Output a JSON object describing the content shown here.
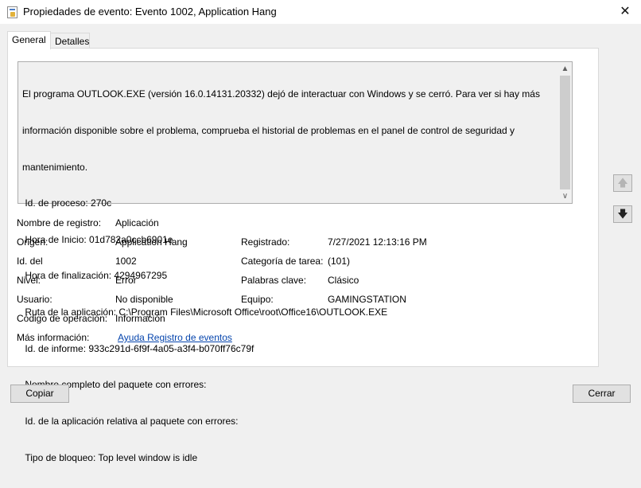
{
  "window": {
    "title": "Propiedades de evento: Evento 1002, Application Hang",
    "close_glyph": "✕"
  },
  "tabs": [
    {
      "label": "General",
      "selected": true
    },
    {
      "label": "Detalles",
      "selected": false
    }
  ],
  "description": {
    "lines": [
      "El programa OUTLOOK.EXE (versión 16.0.14131.20332) dejó de interactuar con Windows y se cerró. Para ver si hay más",
      "información disponible sobre el problema, comprueba el historial de problemas en el panel de control de seguridad y",
      "mantenimiento.",
      " Id. de proceso: 270c",
      " Hora de Inicio: 01d782a0ccb6901e",
      " Hora de finalización: 4294967295",
      " Ruta de la aplicación: C:\\Program Files\\Microsoft Office\\root\\Office16\\OUTLOOK.EXE",
      " Id. de informe: 933c291d-6f9f-4a05-a3f4-b070ff76c79f",
      " Nombre completo del paquete con errores:",
      " Id. de la aplicación relativa al paquete con errores:",
      " Tipo de bloqueo: Top level window is idle"
    ],
    "scroll_up_glyph": "▲",
    "scroll_down_glyph": "∨"
  },
  "side_buttons": {
    "up_icon": "arrow-up-icon",
    "down_icon": "arrow-down-icon",
    "up_glyph": "🡅",
    "down_glyph": "🡇"
  },
  "fields": {
    "log_name": {
      "label": "Nombre de registro:",
      "value": "Aplicación"
    },
    "source": {
      "label": "Origen:",
      "value": "Application Hang"
    },
    "logged": {
      "label": "Registrado:",
      "value": "7/27/2021 12:13:16 PM"
    },
    "event_id": {
      "label": "Id. del",
      "value": "1002"
    },
    "task_category": {
      "label": "Categoría de tarea:",
      "value": "(101)"
    },
    "level": {
      "label": "Nivel:",
      "value": "Error"
    },
    "keywords": {
      "label": "Palabras clave:",
      "value": "Clásico"
    },
    "user": {
      "label": "Usuario:",
      "value": "No disponible"
    },
    "computer": {
      "label": "Equipo:",
      "value": "GAMINGSTATION"
    },
    "opcode": {
      "label": "Código de operación:",
      "value": "Información"
    },
    "more_info": {
      "label": "Más información:",
      "value": "Ayuda Registro de eventos"
    }
  },
  "buttons": {
    "copy": "Copiar",
    "close": "Cerrar"
  },
  "colors": {
    "link": "#0645ad",
    "background": "#f0f0f0"
  }
}
